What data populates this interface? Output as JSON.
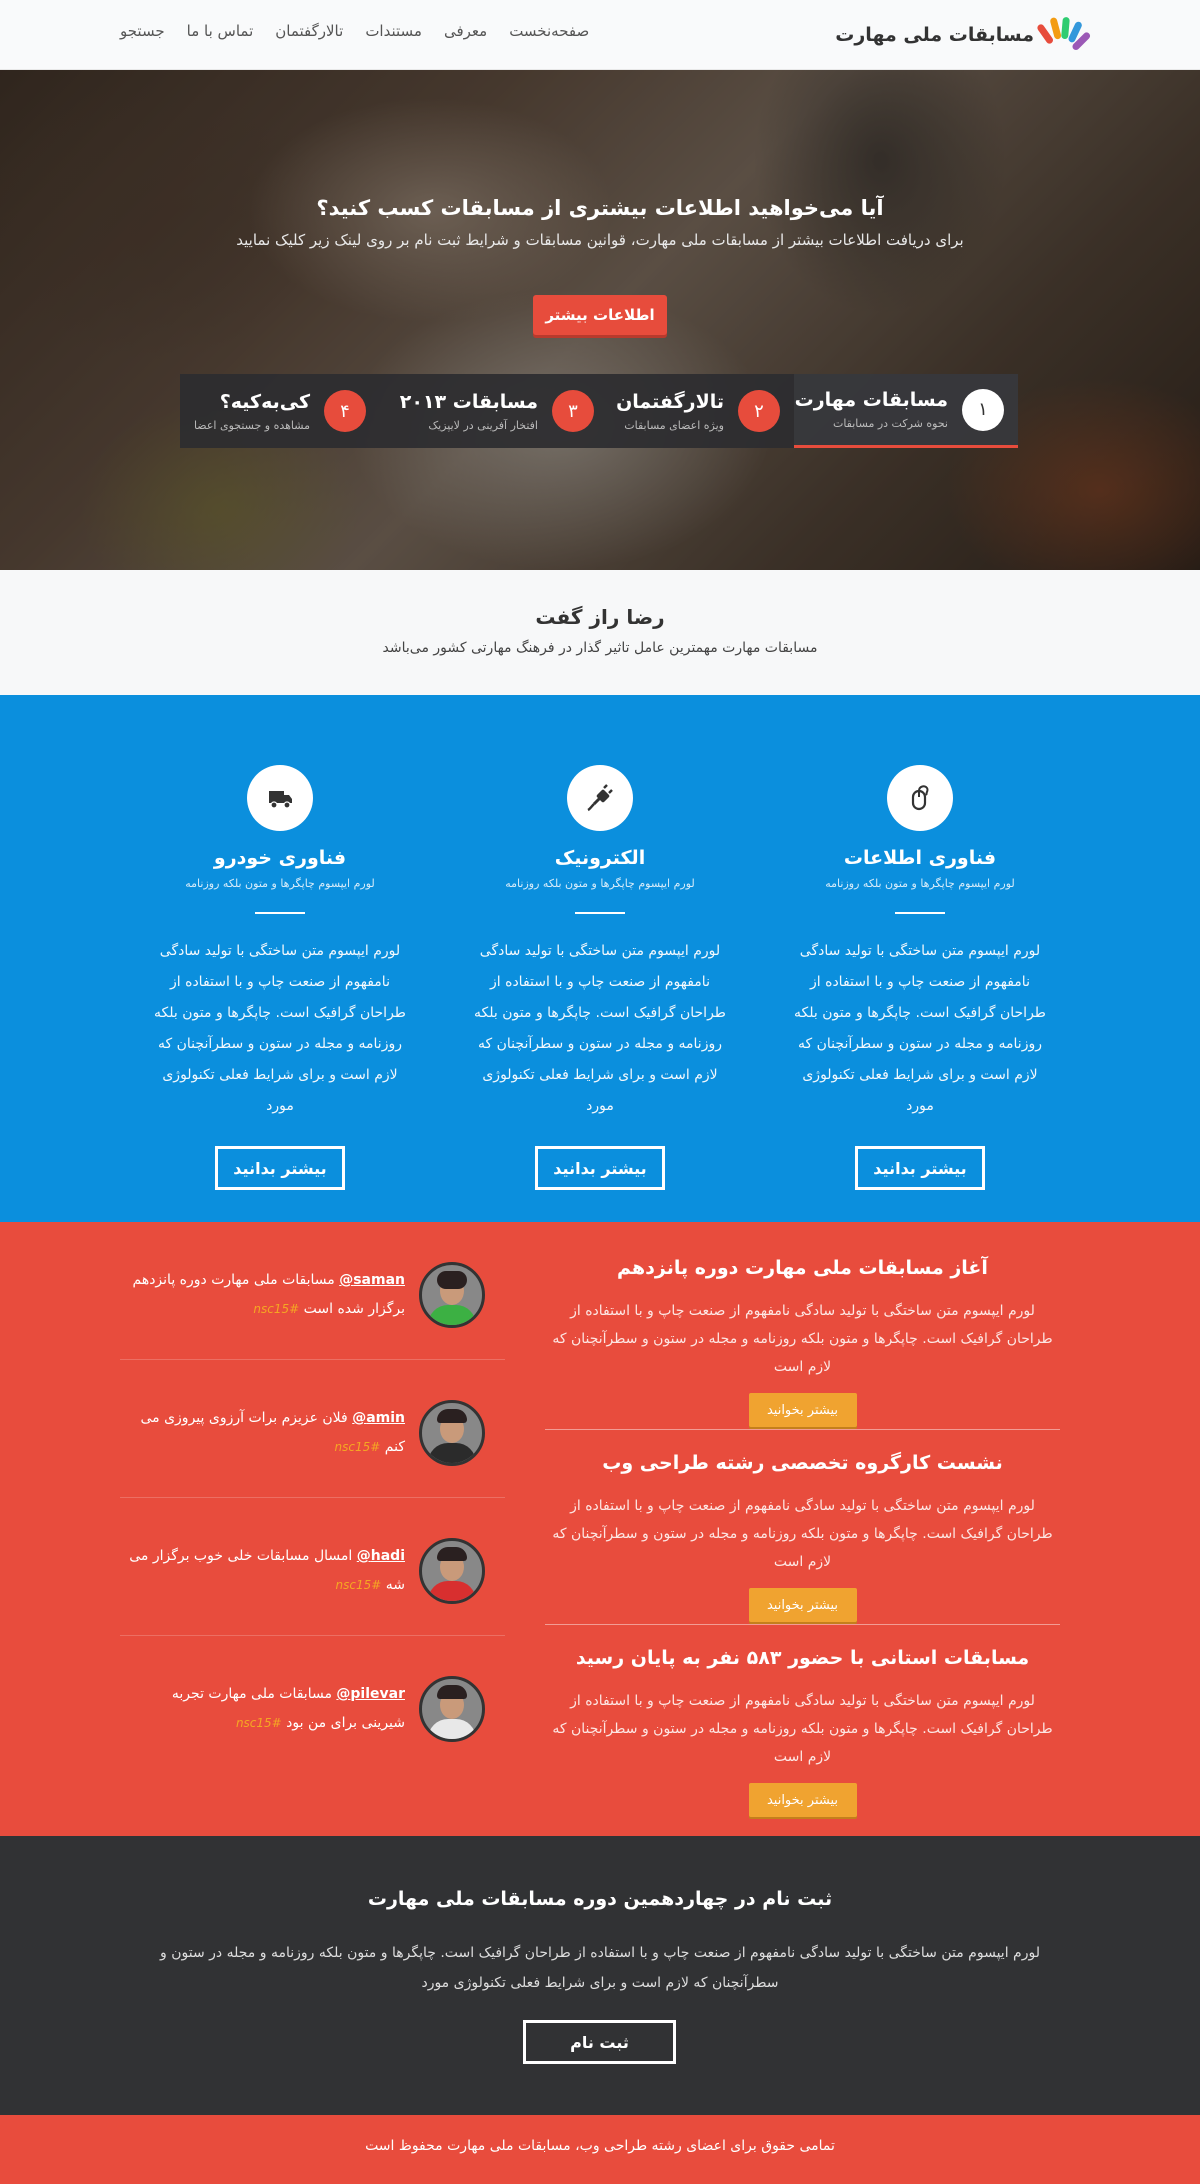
{
  "brand": {
    "title": "مسابقات ملی مهارت"
  },
  "nav": {
    "items": [
      "صفحه‌نخست",
      "معرفی",
      "مستندات",
      "تالارگفتمان",
      "تماس با ما",
      "جستجو"
    ]
  },
  "hero": {
    "title": "آیا می‌خواهید اطلاعات بیشتری از مسابقات کسب کنید؟",
    "subtitle": "برای دریافت اطلاعات بیشتر از مسابقات ملی مهارت، قوانین مسابقات و شرایط ثبت نام بر روی لینک زیر کلیک نمایید",
    "button": "اطلاعات بیشتر"
  },
  "steps": [
    {
      "num": "۱",
      "title": "مسابقات مهارت",
      "desc": "نحوه شرکت در مسابقات"
    },
    {
      "num": "۲",
      "title": "تالارگفتمان",
      "desc": "ویژه اعضای مسابقات"
    },
    {
      "num": "۳",
      "title": "مسابقات ۲۰۱۳",
      "desc": "افتخار آفرینی در لایپزیک"
    },
    {
      "num": "۴",
      "title": "کی‌به‌کیه؟",
      "desc": "مشاهده و جستجوی اعضا"
    }
  ],
  "quote": {
    "title": "رضا راز گفت",
    "subtitle": "مسابقات مهارت مهمترین عامل تاثیر گذار در فرهنگ مهارتی کشور می‌باشد"
  },
  "services": [
    {
      "icon": "mouse-icon",
      "title": "فناوری اطلاعات",
      "sub": "لورم ایپسوم چاپگرها و متون بلکه روزنامه",
      "body": "لورم ایپسوم متن ساختگی با تولید سادگی نامفهوم از صنعت چاپ و با استفاده از طراحان گرافیک است. چاپگرها و متون بلکه روزنامه و مجله در ستون و سطرآنچنان که لازم است و برای شرایط فعلی تکنولوژی مورد",
      "button": "بیشتر بدانید"
    },
    {
      "icon": "plug-icon",
      "title": "الکترونیک",
      "sub": "لورم ایپسوم چاپگرها و متون بلکه روزنامه",
      "body": "لورم ایپسوم متن ساختگی با تولید سادگی نامفهوم از صنعت چاپ و با استفاده از طراحان گرافیک است. چاپگرها و متون بلکه روزنامه و مجله در ستون و سطرآنچنان که لازم است و برای شرایط فعلی تکنولوژی مورد",
      "button": "بیشتر بدانید"
    },
    {
      "icon": "truck-icon",
      "title": "فناوری خودرو",
      "sub": "لورم ایپسوم چاپگرها و متون بلکه روزنامه",
      "body": "لورم ایپسوم متن ساختگی با تولید سادگی نامفهوم از صنعت چاپ و با استفاده از طراحان گرافیک است. چاپگرها و متون بلکه روزنامه و مجله در ستون و سطرآنچنان که لازم است و برای شرایط فعلی تکنولوژی مورد",
      "button": "بیشتر بدانید"
    }
  ],
  "articles": [
    {
      "title": "آغاز مسابقات ملی مهارت دوره پانزدهم",
      "body": "لورم ایپسوم متن ساختگی با تولید سادگی نامفهوم از صنعت چاپ و با استفاده از طراحان گرافیک است. چاپگرها و متون بلکه روزنامه و مجله در ستون و سطرآنچنان که لازم است",
      "button": "بیشتر بخوانید"
    },
    {
      "title": "نشست کارگروه تخصصی رشته طراحی وب",
      "body": "لورم ایپسوم متن ساختگی با تولید سادگی نامفهوم از صنعت چاپ و با استفاده از طراحان گرافیک است. چاپگرها و متون بلکه روزنامه و مجله در ستون و سطرآنچنان که لازم است",
      "button": "بیشتر بخوانید"
    },
    {
      "title": "مسابقات استانی با حضور ۵۸۳ نفر به پایان رسید",
      "body": "لورم ایپسوم متن ساختگی با تولید سادگی نامفهوم از صنعت چاپ و با استفاده از طراحان گرافیک است. چاپگرها و متون بلکه روزنامه و مجله در ستون و سطرآنچنان که لازم است",
      "button": "بیشتر بخوانید"
    }
  ],
  "tweets": [
    {
      "user": "saman@",
      "text": " مسابقات ملی مهارت دوره پانزدهم برگزار شده است ",
      "tag": "#nsc15"
    },
    {
      "user": "amin@",
      "text": " فلان عزیزم برات آرزوی پیروزی می کنم ",
      "tag": "#nsc15"
    },
    {
      "user": "hadi@",
      "text": " امسال مسابقات خلی خوب برگزار می شه ",
      "tag": "#nsc15"
    },
    {
      "user": "pilevar@",
      "text": " مسابقات ملی مهارت تجربه شیرینی برای من بود ",
      "tag": "#nsc15"
    }
  ],
  "cta": {
    "title": "ثبت نام در چهاردهمین دوره مسابقات ملی مهارت",
    "body": "لورم ایپسوم متن ساختگی با تولید سادگی نامفهوم از صنعت چاپ و با استفاده از طراحان گرافیک است. چاپگرها و متون بلکه روزنامه و مجله در ستون و سطرآنچنان که لازم است و برای شرایط فعلی تکنولوژی مورد",
    "button": "ثبت نام"
  },
  "footer": {
    "text": "تمامی حقوق برای اعضای رشته طراحی وب، مسابقات ملی مهارت محفوظ است"
  },
  "colors": {
    "accent": "#e74c3c",
    "blue": "#0b8fdd",
    "dark": "#313234",
    "orange": "#f0a330"
  }
}
